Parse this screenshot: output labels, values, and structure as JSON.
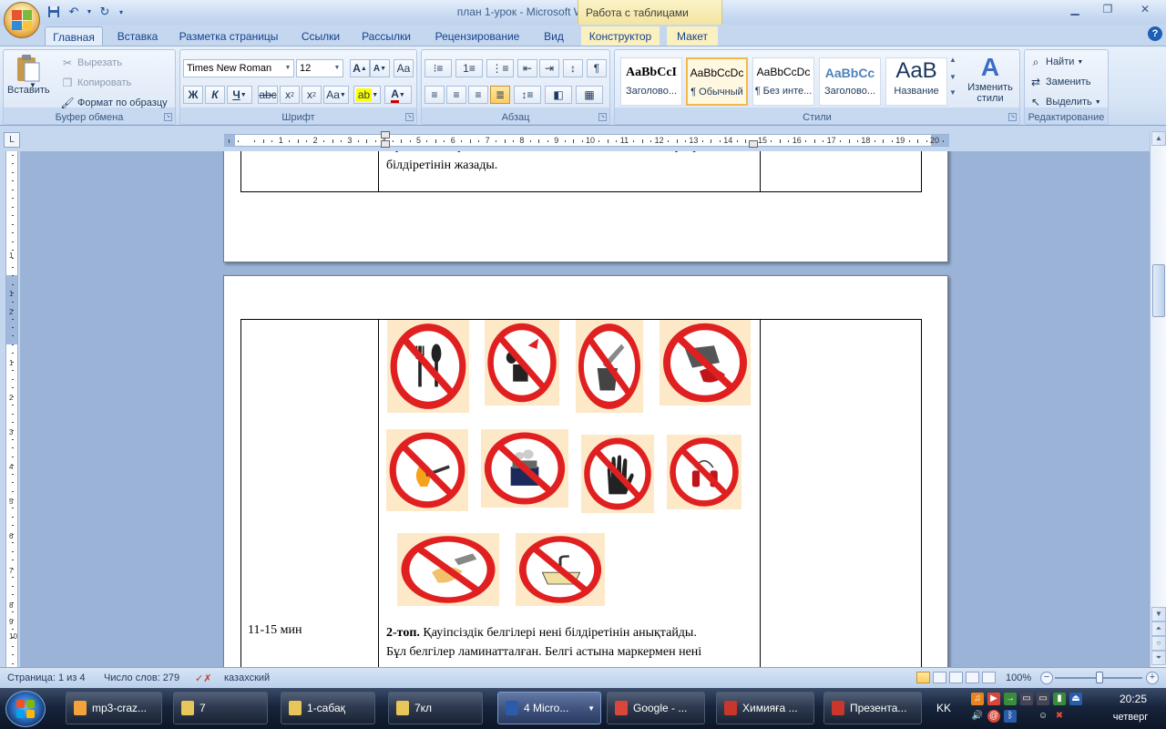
{
  "window": {
    "title": "план 1-урок - Microsoft Word",
    "context_tab_group": "Работа с таблицами"
  },
  "tabs": [
    "Главная",
    "Вставка",
    "Разметка страницы",
    "Ссылки",
    "Рассылки",
    "Рецензирование",
    "Вид",
    "Конструктор",
    "Макет"
  ],
  "ribbon": {
    "clipboard": {
      "paste": "Вставить",
      "cut": "Вырезать",
      "copy": "Копировать",
      "format_painter": "Формат по образцу",
      "label": "Буфер обмена"
    },
    "font": {
      "family": "Times New Roman",
      "size": "12",
      "label": "Шрифт"
    },
    "paragraph": {
      "label": "Абзац"
    },
    "styles": {
      "items": [
        {
          "sample": "AaBbCcI",
          "name": "Заголово..."
        },
        {
          "sample": "AaBbCcDc",
          "name": "¶ Обычный"
        },
        {
          "sample": "AaBbCcDc",
          "name": "¶ Без инте..."
        },
        {
          "sample": "AaBbCc",
          "name": "Заголово..."
        },
        {
          "sample": "AaB",
          "name": "Название"
        }
      ],
      "change": "Изменить стили",
      "label": "Стили"
    },
    "editing": {
      "find": "Найти",
      "replace": "Заменить",
      "select": "Выделить",
      "label": "Редактирование"
    }
  },
  "ruler": {
    "numbers": [
      "1",
      "2",
      "3",
      "4",
      "5",
      "6",
      "7",
      "8",
      "9",
      "10",
      "11",
      "12",
      "13",
      "14",
      "15",
      "16",
      "17",
      "18",
      "19",
      "20"
    ],
    "vertical_numbers": [
      "1",
      "1",
      "2",
      "1",
      "2",
      "3",
      "4",
      "5",
      "6",
      "7",
      "8",
      "9",
      "10"
    ]
  },
  "document": {
    "page1_text": "Бұл белгілер ламинатталған. Белгі астына маркермен нені білдіретінін жазады.",
    "time": "11-15 мин",
    "group_bold": "2-топ.",
    "group_text": " Қауіпсіздік белгілері нені білдіретінін анықтайды.",
    "laminated_text": "Бұл белгілер ламинатталған. Белгі астына маркермен нені"
  },
  "status": {
    "page": "Страница: 1 из 4",
    "words": "Число слов: 279",
    "language": "казахский",
    "zoom": "100%",
    "zoom_level": 100
  },
  "taskbar": {
    "items": [
      {
        "label": "mp3-craz...",
        "color": "#f2a33a"
      },
      {
        "label": "7",
        "color": "#e8c65a"
      },
      {
        "label": "1-сабақ",
        "color": "#e8c65a"
      },
      {
        "label": "7кл",
        "color": "#e8c65a"
      },
      {
        "label": "4 Micro...",
        "color": "#2a5caa"
      },
      {
        "label": "Google - ...",
        "color": "#d9473b"
      },
      {
        "label": "Химияға ...",
        "color": "#c8362c"
      },
      {
        "label": "Презента...",
        "color": "#c8362c"
      }
    ],
    "lang": "KK",
    "time": "20:25",
    "day": "четверг"
  },
  "colors": {
    "sign_ring": "#e02020",
    "sign_bg": "#fde9c8",
    "accent": "#15428b"
  }
}
